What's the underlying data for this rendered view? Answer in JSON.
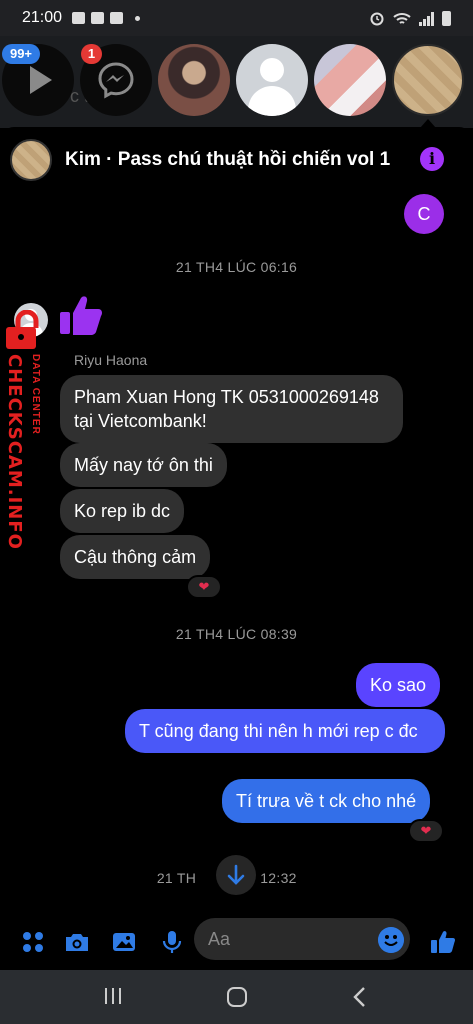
{
  "status_bar": {
    "time": "21:00"
  },
  "chat_heads": {
    "background_text": "c  tảo 1",
    "badges": {
      "video": "99+",
      "messenger": "1"
    }
  },
  "header": {
    "title": "Kim · Pass chú thuật hồi chiến vol 1",
    "info_icon": "i"
  },
  "my_avatar_letter": "C",
  "timestamps": [
    "21 TH4 LÚC 06:16",
    "21 TH4 LÚC 08:39",
    "21 TH",
    "12:32"
  ],
  "incoming": {
    "sender": "Riyu Haona",
    "messages": [
      "Pham Xuan Hong TK 0531000269148 tại Vietcombank!",
      "Mấy nay tớ ôn thi",
      "Ko rep ib dc",
      "Cậu thông cảm"
    ]
  },
  "outgoing": {
    "messages": [
      "Ko sao",
      "T cũng đang thi nên h mới rep c đc",
      "Tí trưa về t ck cho nhé"
    ]
  },
  "reactions": {
    "incoming_last": "❤",
    "outgoing_last": "❤"
  },
  "watermark": {
    "main": "CHECKSCAM.INFO",
    "sub": "DATA CENTER"
  },
  "composer": {
    "placeholder": "Aa"
  },
  "icons": [
    "play-icon",
    "messenger-icon",
    "info-icon",
    "thumbs-up-icon",
    "apps-icon",
    "camera-icon",
    "image-icon",
    "mic-icon",
    "emoji-icon",
    "like-icon",
    "arrow-down-icon",
    "recents-icon",
    "home-icon",
    "back-icon"
  ],
  "colors": {
    "accent_purple": "#a334fa",
    "outgoing_blue_top": "#5248ff",
    "outgoing_blue_bottom": "#2f7be5",
    "incoming_bubble": "#303030"
  }
}
